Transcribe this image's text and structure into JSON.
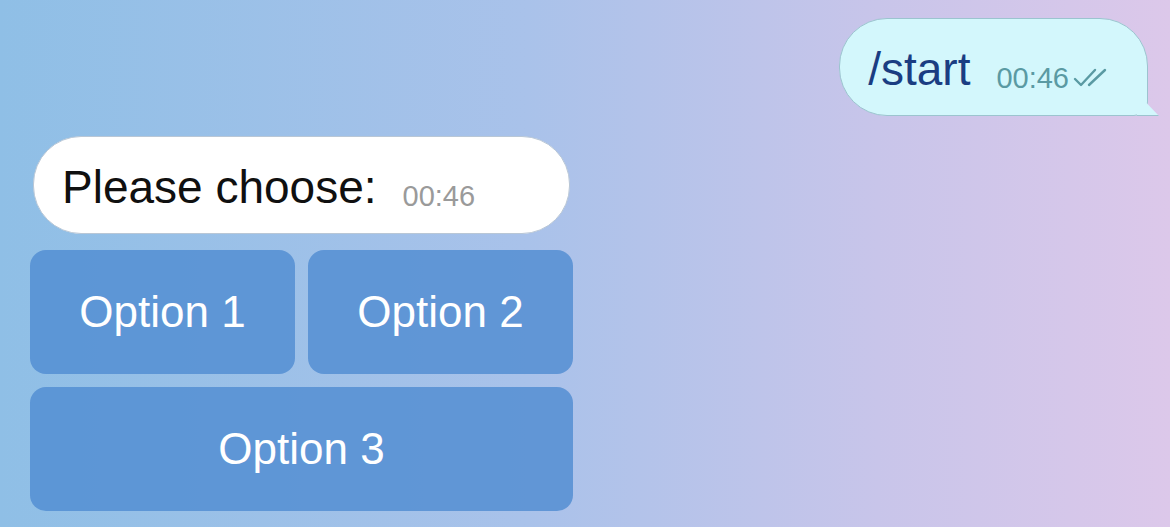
{
  "chat": {
    "messages": [
      {
        "text": "/start",
        "time": "00:46",
        "outgoing": true,
        "read": true
      },
      {
        "text": "Please choose:",
        "time": "00:46",
        "outgoing": false,
        "read": false
      }
    ]
  },
  "keyboard": {
    "rows": [
      {
        "buttons": [
          {
            "label": "Option 1"
          },
          {
            "label": "Option 2"
          }
        ]
      },
      {
        "buttons": [
          {
            "label": "Option 3"
          }
        ]
      }
    ]
  }
}
